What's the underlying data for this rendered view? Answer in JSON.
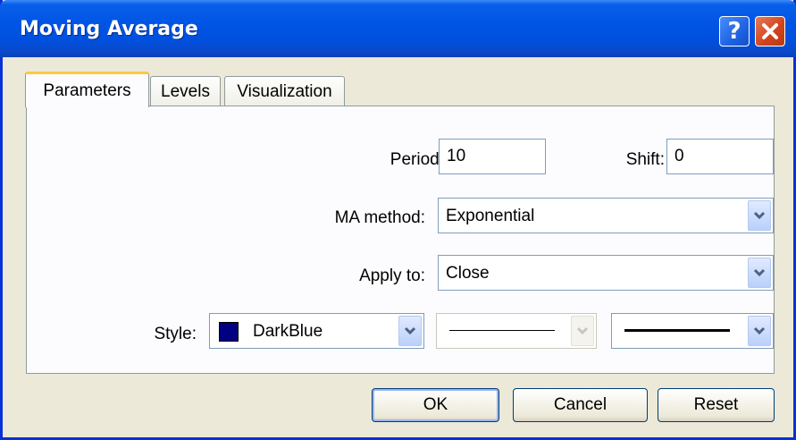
{
  "window": {
    "title": "Moving Average"
  },
  "tabs": [
    {
      "label": "Parameters",
      "active": true
    },
    {
      "label": "Levels",
      "active": false
    },
    {
      "label": "Visualization",
      "active": false
    }
  ],
  "params": {
    "period_label": "Period:",
    "period_value": "10",
    "shift_label": "Shift:",
    "shift_value": "0",
    "ma_method_label": "MA method:",
    "ma_method_value": "Exponential",
    "apply_to_label": "Apply to:",
    "apply_to_value": "Close",
    "style_label": "Style:",
    "color_value": "DarkBlue",
    "color_hex": "#000080"
  },
  "buttons": {
    "ok": "OK",
    "cancel": "Cancel",
    "reset": "Reset"
  },
  "icons": {
    "help": "help-icon",
    "close": "close-icon",
    "dropdown": "chevron-down-icon"
  },
  "colors": {
    "titlebar": "#0055e5",
    "frame": "#0831d9",
    "tab_highlight": "#ffc83c",
    "close_button": "#d1431a"
  }
}
